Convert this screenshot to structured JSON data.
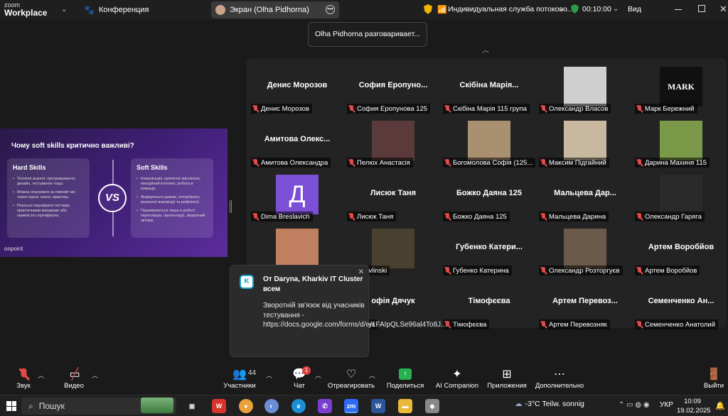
{
  "app": {
    "brand_top": "zoom",
    "brand_bottom": "Workplace",
    "meeting_label": "Конференция"
  },
  "header": {
    "screen_share_label": "Экран (Olha Pidhorna)",
    "service_label": "Индивидуальная служба потоково...",
    "timer": "00:10:00",
    "view_label": "Вид"
  },
  "talking_banner": "Olha Pidhorna разговаривает...",
  "slide": {
    "title": "Чому soft skills критично важливі?",
    "hard": {
      "heading": "Hard Skills",
      "points": [
        "Технічні знання: програмування, дизайн, тестування тощо.",
        "Можна опанувати за певний час через курси, книги, практику.",
        "Реально перевірити тестами, практичними вправами або наявністю сертифіката."
      ]
    },
    "soft": {
      "heading": "Soft Skills",
      "points": [
        "Комунікація, критичне мислення, емоційний інтелект, робота в команді.",
        "Формуються довше, потребують реальної взаємодії та рефлексії.",
        "Перевіряються лише в роботі: переговори, презентації, зворотний зв'язок."
      ]
    },
    "vs": "VS",
    "logo": "onpoint"
  },
  "participants": [
    {
      "big": "Денис Морозов",
      "label": "Денис Морозов"
    },
    {
      "big": "София  Еропуно...",
      "label": "София Еропунова 125"
    },
    {
      "big": "Скібіна  Марія...",
      "label": "Скібіна Марія 115 група"
    },
    {
      "big": "",
      "label": "Олександр Власов",
      "photo": "#cfcfcf"
    },
    {
      "big": "",
      "label": "Марк Бережний",
      "photo": "#111111",
      "photo_text": "MARK"
    },
    {
      "big": "Амитова  Олекс...",
      "label": "Амитова Олександра"
    },
    {
      "big": "",
      "label": "Пелюх Анастасія",
      "photo": "#5a3a3a"
    },
    {
      "big": "",
      "label": "Богомолова Софія (125...",
      "photo": "#a89070"
    },
    {
      "big": "",
      "label": "Максим Підгайний",
      "photo": "#c8b8a0"
    },
    {
      "big": "",
      "label": "Дарина Махиня 115",
      "photo": "#7a9a4a"
    },
    {
      "big": "",
      "label": "Dima Breslavich",
      "letter": "Д"
    },
    {
      "big": "Лисюк Таня",
      "label": "Лисюк Таня"
    },
    {
      "big": "Божко Даяна 125",
      "label": "Божко Даяна 125"
    },
    {
      "big": "Мальцева  Дар...",
      "label": "Мальцева Дарина"
    },
    {
      "big": "",
      "label": "Олександр Гаряга",
      "photo": "#2a2a2a"
    },
    {
      "big": "",
      "label": "",
      "photo": "#c08060"
    },
    {
      "big": "",
      "label": "l Pavlinski",
      "photo": "#4a4030"
    },
    {
      "big": "Губенко  Катери...",
      "label": "Губенко Катерина"
    },
    {
      "big": "",
      "label": "Олександр Розторгуєв",
      "photo": "#6a5a4a"
    },
    {
      "big": "Артем Воробйов",
      "label": "Артем Воробйов"
    },
    {
      "big": "",
      "label": "",
      "photo": ""
    },
    {
      "big": "офія Дячук",
      "label": "Дячук"
    },
    {
      "big": "Тімофєєва",
      "label": "Тімофєєва"
    },
    {
      "big": "Артем  Перевоз...",
      "label": "Артем Перевозняк"
    },
    {
      "big": "Семенченко  Ан...",
      "label": "Семенченко Анатолий"
    }
  ],
  "notification": {
    "logo": "K",
    "from": "От Daryna, Kharkiv IT Cluster всем",
    "body": "Зворотній зв'язок від учасників тестування - https://docs.google.com/forms/d/e/1FAIpQLSe96al4To8J..."
  },
  "toolbar": {
    "audio": "Звук",
    "video": "Видео",
    "participants": "Участники",
    "participants_count": "44",
    "chat": "Чат",
    "chat_badge": "1",
    "react": "Отреагировать",
    "share": "Поделиться",
    "ai": "AI Companion",
    "apps": "Приложения",
    "more": "Дополнительно",
    "exit": "Выйти"
  },
  "taskbar": {
    "search_placeholder": "Пошук",
    "weather": "-3°C  Teilw. sonnig",
    "lang": "УКР",
    "time": "10:09",
    "date": "19.02.2025",
    "weather_badge": "1"
  }
}
